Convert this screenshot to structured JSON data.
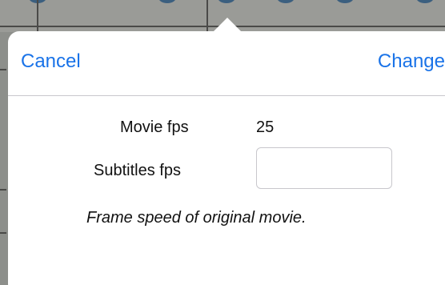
{
  "popover": {
    "cancel_label": "Cancel",
    "change_label": "Change",
    "movie_fps_label": "Movie fps",
    "movie_fps_value": "25",
    "subtitles_fps_label": "Subtitles fps",
    "subtitles_fps_value": "",
    "hint_text": "Frame speed of original movie."
  },
  "colors": {
    "accent": "#1a73e8",
    "separator": "#c8c7cc"
  }
}
